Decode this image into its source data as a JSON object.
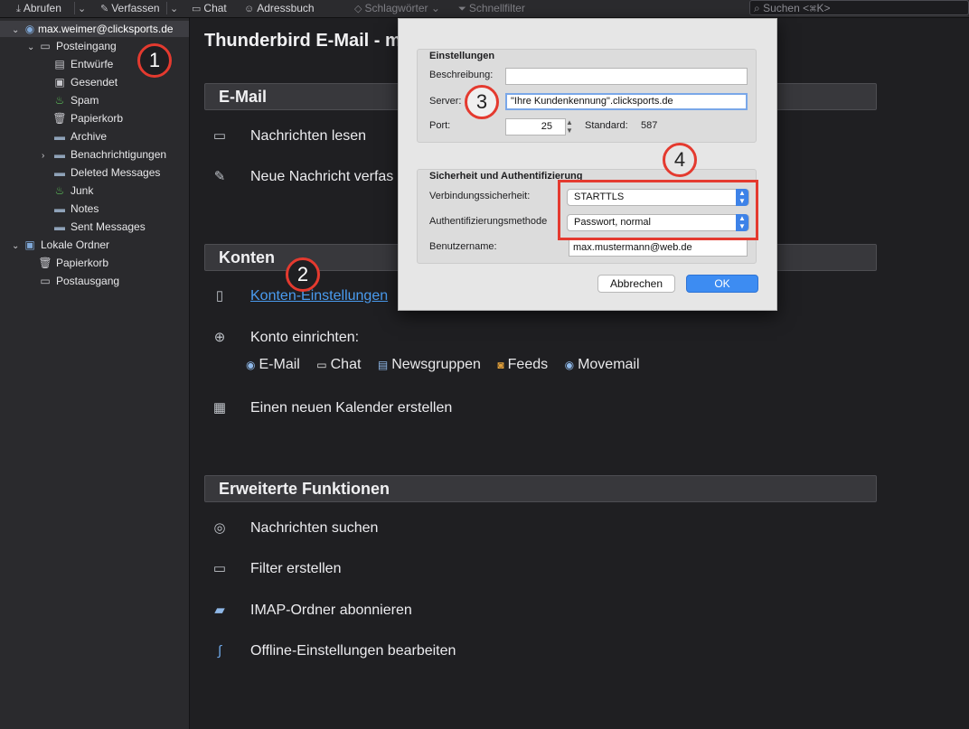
{
  "toolbar": {
    "get_messages": "Abrufen",
    "write": "Verfassen",
    "chat": "Chat",
    "address_book": "Adressbuch",
    "tags": "Schlagwörter",
    "quick_filter": "Schnellfilter",
    "search_placeholder": "Suchen <⌘K>"
  },
  "sidebar": {
    "account": "max.weimer@clicksports.de",
    "inbox": "Posteingang",
    "folders": [
      "Entwürfe",
      "Gesendet",
      "Spam",
      "Papierkorb",
      "Archive",
      "Benachrichtigungen",
      "Deleted Messages",
      "Junk",
      "Notes",
      "Sent Messages"
    ],
    "local_folders": "Lokale Ordner",
    "local_items": [
      "Papierkorb",
      "Postausgang"
    ]
  },
  "main": {
    "title": "Thunderbird E-Mail - m",
    "email_section": "E-Mail",
    "read_messages": "Nachrichten lesen",
    "new_message": "Neue Nachricht verfas",
    "accounts_section": "Konten",
    "account_settings": "Konten-Einstellungen",
    "setup_account": "Konto einrichten:",
    "setup_options": [
      "E-Mail",
      "Chat",
      "Newsgruppen",
      "Feeds",
      "Movemail"
    ],
    "new_calendar": "Einen neuen Kalender erstellen",
    "advanced_section": "Erweiterte Funktionen",
    "search_messages": "Nachrichten suchen",
    "create_filter": "Filter erstellen",
    "imap_subscribe": "IMAP-Ordner abonnieren",
    "offline_settings": "Offline-Einstellungen bearbeiten"
  },
  "dialog": {
    "settings_title": "Einstellungen",
    "description_label": "Beschreibung:",
    "description_value": "",
    "server_label": "Server:",
    "server_value": "\"Ihre Kundenkennung\".clicksports.de",
    "port_label": "Port:",
    "port_value": "25",
    "default_label": "Standard:",
    "default_value": "587",
    "security_title": "Sicherheit und Authentifizierung",
    "conn_security_label": "Verbindungssicherheit:",
    "conn_security_value": "STARTTLS",
    "auth_method_label": "Authentifizierungsmethode",
    "auth_method_value": "Passwort, normal",
    "username_label": "Benutzername:",
    "username_value": "max.mustermann@web.de",
    "cancel": "Abbrechen",
    "ok": "OK"
  },
  "annotations": [
    "1",
    "2",
    "3",
    "4"
  ]
}
